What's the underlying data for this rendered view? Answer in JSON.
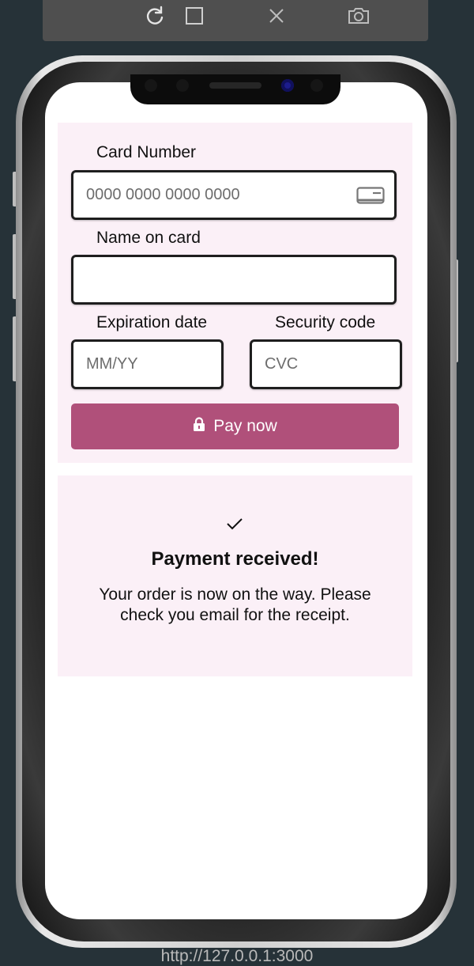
{
  "toolbar": {
    "icons": [
      "rotate-icon",
      "square-icon",
      "close-icon",
      "camera-icon"
    ]
  },
  "form": {
    "card_number_label": "Card Number",
    "card_number_placeholder": "0000 0000 0000 0000",
    "card_number_value": "",
    "name_label": "Name on card",
    "name_value": "",
    "expiration_label": "Expiration date",
    "expiration_placeholder": "MM/YY",
    "expiration_value": "",
    "security_label": "Security code",
    "security_placeholder": "CVC",
    "security_value": "",
    "pay_button_label": "Pay now"
  },
  "success": {
    "title": "Payment received!",
    "message": "Your order is now on the way. Please check you email for the receipt."
  },
  "url": "http://127.0.0.1:3000",
  "colors": {
    "background": "#263238",
    "card_bg": "#fbf0f7",
    "accent": "#b0507a"
  }
}
